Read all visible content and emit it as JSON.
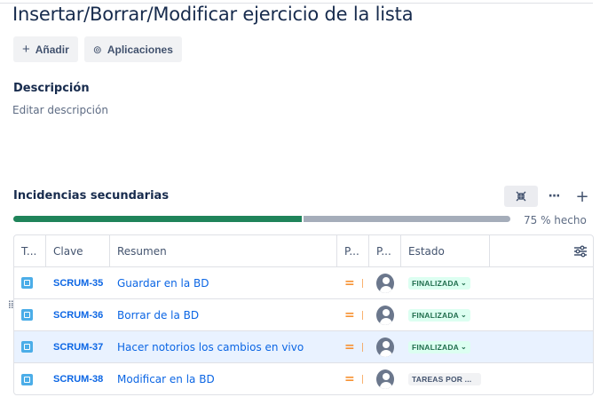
{
  "page": {
    "title": "Insertar/Borrar/Modificar ejercicio de la lista"
  },
  "actions": {
    "add_label": "Añadir",
    "add_icon": "plus-icon",
    "apps_label": "Aplicaciones",
    "apps_icon": "apps-icon"
  },
  "description": {
    "heading": "Descripción",
    "placeholder": "Editar descripción"
  },
  "subtasks": {
    "heading": "Incidencias secundarias",
    "progress_percent": 75,
    "progress_text": "75 % hecho",
    "toolbar": {
      "collapse_icon": "collapse-icon",
      "more_label": "···",
      "add_label": "+"
    },
    "columns": {
      "type": "T...",
      "key": "Clave",
      "summary": "Resumen",
      "priority": "P...",
      "assignee": "P...",
      "status": "Estado",
      "settings_icon": "column-settings-icon"
    },
    "rows": [
      {
        "key": "SCRUM-35",
        "summary": "Guardar en la BD",
        "priority_icon": "=",
        "status": "FINALIZADA",
        "status_kind": "done"
      },
      {
        "key": "SCRUM-36",
        "summary": "Borrar de la BD",
        "priority_icon": "=",
        "status": "FINALIZADA",
        "status_kind": "done"
      },
      {
        "key": "SCRUM-37",
        "summary": "Hacer notorios los cambios en vivo",
        "priority_icon": "=",
        "status": "FINALIZADA",
        "status_kind": "done"
      },
      {
        "key": "SCRUM-38",
        "summary": "Modificar en la BD",
        "priority_icon": "=",
        "status": "TAREAS POR ...",
        "status_kind": "todo"
      }
    ]
  },
  "colors": {
    "progress_done": "#1f845a",
    "progress_rest": "#a5adba",
    "link": "#0c66e4",
    "priority": "#f79233"
  }
}
